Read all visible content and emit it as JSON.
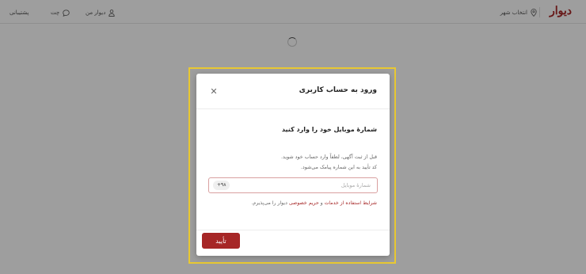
{
  "header": {
    "logo": "دیوار",
    "city_label": "انتخاب شهر",
    "nav": {
      "my_divar": "دیوار من",
      "chat": "چت",
      "support": "پشتیبانی"
    }
  },
  "modal": {
    "title": "ورود به حساب کاربری",
    "close_symbol": "✕",
    "heading": "شمارهٔ موبایل خود را وارد کنید",
    "description_line1": "قبل از ثبت آگهی، لطفاً وارد حساب خود شوید.",
    "description_line2": "کد تأیید به این شماره پیامک می‌شود.",
    "phone": {
      "placeholder": "شمارهٔ موبایل",
      "value": "",
      "country_code": "+۹۸"
    },
    "terms": {
      "link_text": "شرایط استفاده از خدمات",
      "connector": " و ",
      "link_text2": "حریم خصوصی",
      "suffix": " دیوار را می‌پذیرم."
    },
    "confirm_label": "تأیید"
  },
  "colors": {
    "brand": "#a62626",
    "highlight": "#e8c832"
  },
  "icons": {
    "location": "location-pin-icon",
    "user": "user-icon",
    "chat": "chat-bubble-icon",
    "close": "close-icon",
    "spinner": "loading-spinner-icon"
  }
}
